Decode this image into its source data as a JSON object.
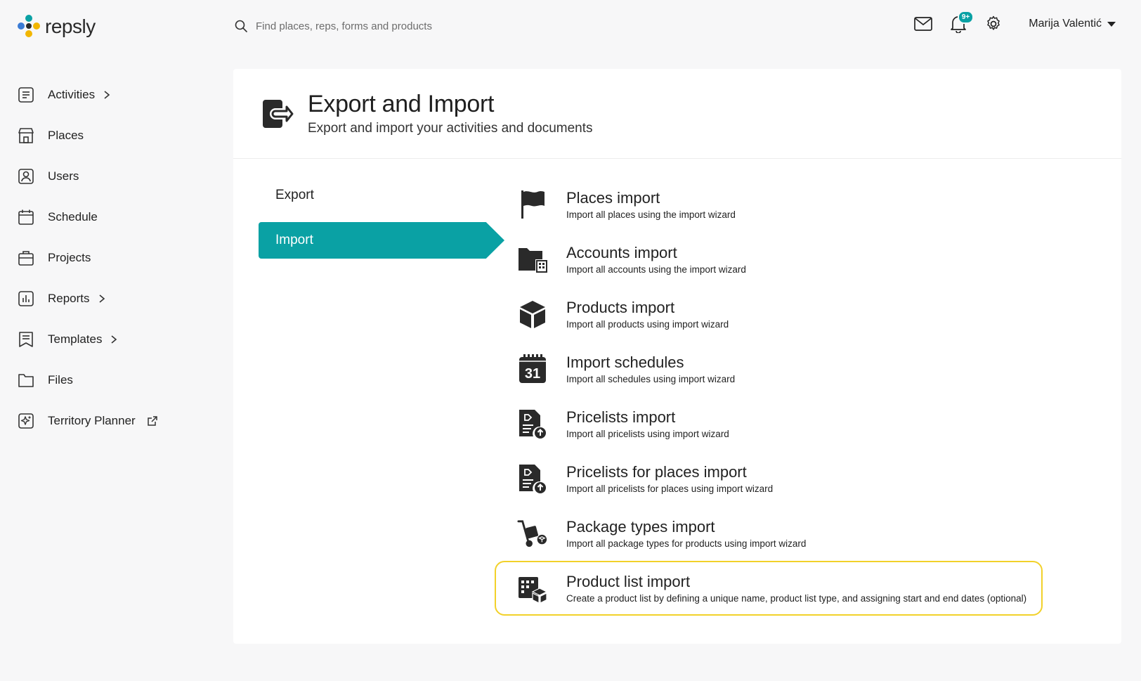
{
  "brand": {
    "name": "repsly"
  },
  "search": {
    "placeholder": "Find places, reps, forms and products"
  },
  "header": {
    "notifications_badge": "9+",
    "user_name": "Marija Valentić"
  },
  "sidebar": {
    "items": [
      {
        "label": "Activities",
        "icon": "activities-icon",
        "has_submenu": true
      },
      {
        "label": "Places",
        "icon": "store-icon",
        "has_submenu": false
      },
      {
        "label": "Users",
        "icon": "user-icon",
        "has_submenu": false
      },
      {
        "label": "Schedule",
        "icon": "calendar-icon",
        "has_submenu": false
      },
      {
        "label": "Projects",
        "icon": "briefcase-icon",
        "has_submenu": false
      },
      {
        "label": "Reports",
        "icon": "bar-chart-icon",
        "has_submenu": true
      },
      {
        "label": "Templates",
        "icon": "template-icon",
        "has_submenu": true
      },
      {
        "label": "Files",
        "icon": "folder-icon",
        "has_submenu": false
      },
      {
        "label": "Territory Planner",
        "icon": "map-sparkle-icon",
        "external": true
      }
    ]
  },
  "page": {
    "title": "Export and Import",
    "subtitle": "Export and import your activities and documents"
  },
  "tabs": [
    {
      "label": "Export",
      "active": false
    },
    {
      "label": "Import",
      "active": true
    }
  ],
  "imports": [
    {
      "title": "Places import",
      "desc": "Import all places using the import wizard",
      "icon": "flag-icon"
    },
    {
      "title": "Accounts import",
      "desc": "Import all accounts using the import wizard",
      "icon": "folder-building-icon"
    },
    {
      "title": "Products import",
      "desc": "Import all products using import wizard",
      "icon": "cube-icon"
    },
    {
      "title": "Import schedules",
      "desc": "Import all schedules using import wizard",
      "icon": "calendar-31-icon",
      "icon_text": "31"
    },
    {
      "title": "Pricelists import",
      "desc": "Import all pricelists using import wizard",
      "icon": "pricelist-upload-icon"
    },
    {
      "title": "Pricelists for places import",
      "desc": "Import all pricelists for places using import wizard",
      "icon": "pricelist-upload-icon"
    },
    {
      "title": "Package types import",
      "desc": "Import all package types for products using import wizard",
      "icon": "hand-truck-icon"
    },
    {
      "title": "Product list import",
      "desc": "Create a product list by defining a unique name, product list type, and assigning start and end dates (optional)",
      "icon": "product-list-icon",
      "highlighted": true
    }
  ],
  "colors": {
    "accent": "#0aa1a4",
    "highlight": "#f2d12a",
    "background": "#f7f7f8",
    "card": "#ffffff"
  }
}
